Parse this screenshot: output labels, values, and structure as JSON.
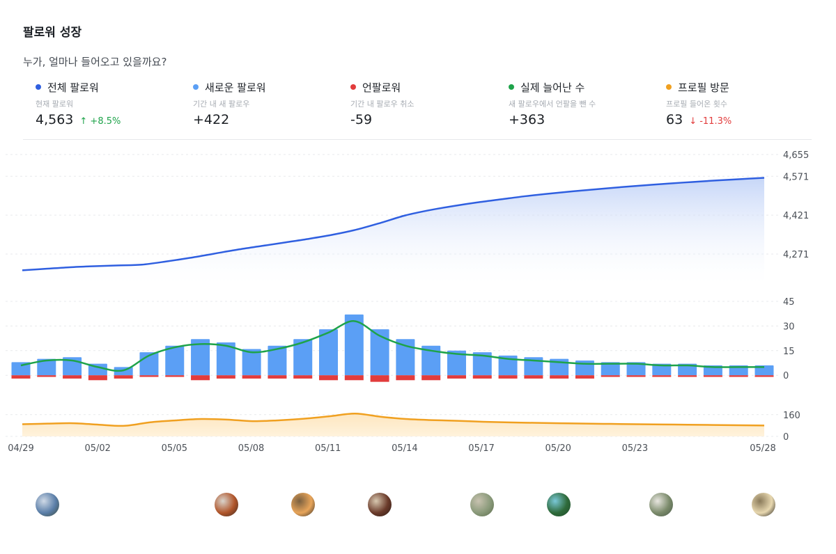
{
  "header": {
    "title": "팔로워 성장",
    "subtitle": "누가, 얼마나 들어오고 있을까요?"
  },
  "stats": [
    {
      "label": "전체 팔로워",
      "desc": "현재 팔로워",
      "value": "4,563",
      "change": "↑ +8.5%",
      "change_dir": "up",
      "color": "#2f5fe0"
    },
    {
      "label": "새로운 팔로워",
      "desc": "기간 내 새 팔로우",
      "value": "+422",
      "change": "",
      "change_dir": "",
      "color": "#5b9ff5"
    },
    {
      "label": "언팔로워",
      "desc": "기간 내 팔로우 취소",
      "value": "-59",
      "change": "",
      "change_dir": "",
      "color": "#e23c3c"
    },
    {
      "label": "실제 늘어난 수",
      "desc": "새 팔로우에서 언팔을 뺀 수",
      "value": "+363",
      "change": "",
      "change_dir": "",
      "color": "#1ea34a"
    },
    {
      "label": "프로필 방문",
      "desc": "프로필 들어온 횟수",
      "value": "63",
      "change": "↓ -11.3%",
      "change_dir": "down",
      "color": "#f0a020"
    }
  ],
  "avatars": [
    {
      "icon": "mountain-lake-photo",
      "day": 1,
      "colors": [
        "#5a7ea8",
        "#cfd9e6",
        "#3d4b3a"
      ]
    },
    {
      "icon": "city-building-photo",
      "day": 8,
      "colors": [
        "#b0552a",
        "#d9d4cc",
        "#3a2a22"
      ]
    },
    {
      "icon": "sunset-field-photo",
      "day": 11,
      "colors": [
        "#e8a55a",
        "#7a6040",
        "#2f2a22"
      ]
    },
    {
      "icon": "food-table-photo",
      "day": 14,
      "colors": [
        "#6a3a2a",
        "#d8c8b0",
        "#2a1a14"
      ]
    },
    {
      "icon": "aerial-terrain-photo",
      "day": 18,
      "colors": [
        "#8a9a7a",
        "#c8c2b0",
        "#5a6a4a"
      ]
    },
    {
      "icon": "aerial-coast-photo",
      "day": 21,
      "colors": [
        "#2e6a3a",
        "#7ac8d8",
        "#1f4a2a"
      ]
    },
    {
      "icon": "street-scene-photo",
      "day": 25,
      "colors": [
        "#7a8a6a",
        "#e8e6e0",
        "#4a5a4a"
      ]
    },
    {
      "icon": "night-light-photo",
      "day": 29,
      "colors": [
        "#e8d8b0",
        "#8a7a5a",
        "#1a1814"
      ]
    }
  ],
  "chart_data": [
    {
      "type": "area",
      "series": [
        {
          "name": "전체 팔로워",
          "color": "#2f5fe0",
          "values": [
            4208,
            4214,
            4220,
            4224,
            4227,
            4230,
            4242,
            4256,
            4272,
            4288,
            4302,
            4316,
            4330,
            4346,
            4366,
            4392,
            4420,
            4440,
            4456,
            4470,
            4482,
            4494,
            4504,
            4513,
            4521,
            4529,
            4536,
            4543,
            4549,
            4555,
            4560,
            4565
          ]
        }
      ],
      "y_ticks": [
        "4,655",
        "4,571",
        "4,421",
        "4,271"
      ],
      "ylim": [
        4150,
        4655
      ]
    },
    {
      "type": "bar",
      "series": [
        {
          "name": "새로운 팔로워",
          "color": "#5b9ff5",
          "values": [
            8,
            10,
            11,
            7,
            5,
            14,
            18,
            22,
            20,
            16,
            18,
            22,
            28,
            37,
            28,
            22,
            18,
            15,
            14,
            12,
            11,
            10,
            9,
            8,
            8,
            7,
            7,
            6,
            6,
            6
          ]
        },
        {
          "name": "언팔로워",
          "color": "#e23c3c",
          "values": [
            -2,
            -1,
            -2,
            -3,
            -2,
            -1,
            -1,
            -3,
            -2,
            -2,
            -2,
            -2,
            -3,
            -3,
            -4,
            -3,
            -3,
            -2,
            -2,
            -2,
            -2,
            -2,
            -2,
            -1,
            -1,
            -1,
            -1,
            -1,
            -1,
            -1
          ]
        },
        {
          "name": "실제 늘어난 수",
          "color": "#1ea34a",
          "values": [
            6,
            9,
            9,
            5,
            3,
            12,
            17,
            19,
            18,
            14,
            16,
            20,
            26,
            33,
            24,
            18,
            15,
            13,
            12,
            10,
            9,
            8,
            7,
            7,
            7,
            6,
            6,
            5,
            5,
            5
          ]
        }
      ],
      "y_ticks": [
        "45",
        "30",
        "15",
        "0"
      ],
      "ylim": [
        -5,
        45
      ]
    },
    {
      "type": "area",
      "series": [
        {
          "name": "프로필 방문",
          "color": "#f0a020",
          "values": [
            90,
            94,
            97,
            86,
            78,
            104,
            118,
            128,
            124,
            112,
            118,
            130,
            148,
            168,
            145,
            128,
            120,
            115,
            108,
            103,
            100,
            97,
            94,
            92,
            90,
            88,
            86,
            84,
            82,
            80
          ]
        }
      ],
      "y_ticks": [
        "160",
        "0"
      ],
      "ylim": [
        0,
        200
      ]
    }
  ],
  "x_axis": {
    "ticks": [
      "04/29",
      "05/02",
      "05/05",
      "05/08",
      "05/11",
      "05/14",
      "05/17",
      "05/20",
      "05/23",
      "05/28"
    ]
  }
}
